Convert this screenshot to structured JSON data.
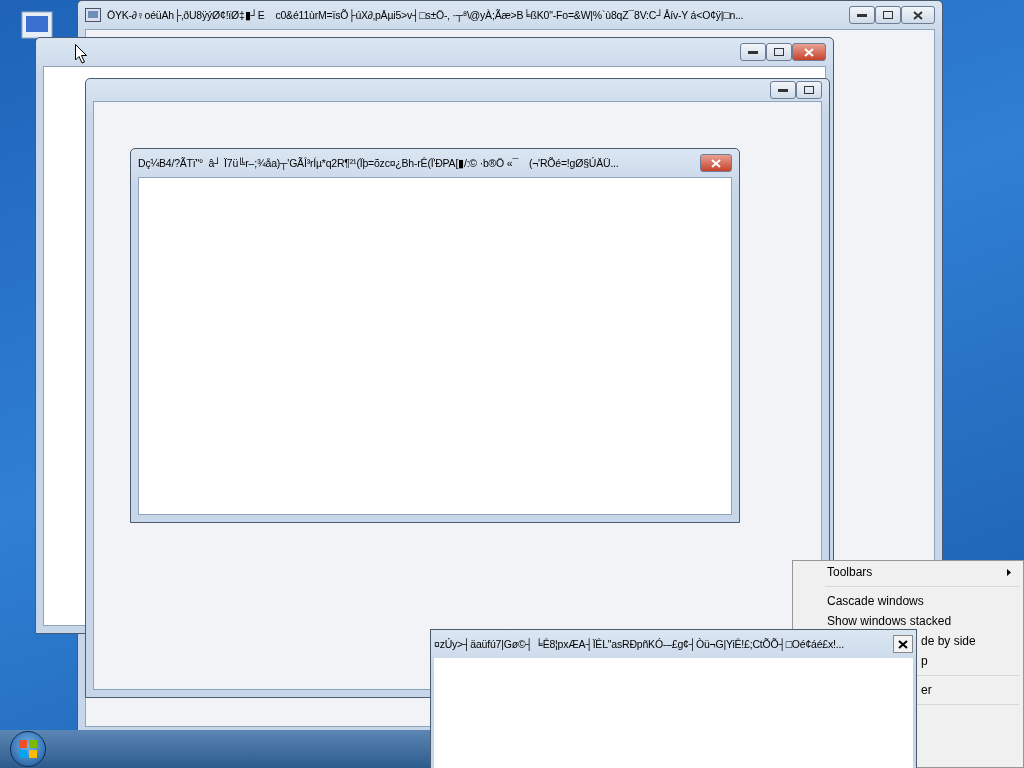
{
  "windows": [
    {
      "kind": "main",
      "title": "ÖYK-∂♀oéüAh├‚ðU8ÿýØ¢!ïØ‡▮┘E    c0&é11ùrM=ïsÕ├úX∂‚pĀµi5>v┤□s±Ö-‚ ·┬⁸\\@yÀ;Ãæ>B╘ßK0\"-Fo=&W|%`ù8qZ¯8V:C┘Åív-Y á<O¢ÿ|□n..."
    },
    {
      "kind": "frame"
    },
    {
      "kind": "inner"
    },
    {
      "kind": "dialog",
      "title": "Dç¼B4/?ÃTï\"°  â┘ Ï7ü╚r–;¾åa)┬'GÃÎ³rÍµ*q2R¶²¹(Ïþ=õzc¤¿Bh-rÊ(Ï'ÐPA[▮/:© ·b®Ö «¯    (¬'RÕé=!gØ§ÚÄÜ..."
    },
    {
      "kind": "tool",
      "title": "¤zÚy>┤äaüfú7|Gø©┤ ╘Ê8¦pxÆA┤ÏÊL\"asRÐpñKÓ-–£g¢┤Òü¬G|YiÊ!£;CtÕÕ┤□Oé¢áé£x!..."
    }
  ],
  "context_menu": {
    "items": [
      {
        "kind": "submenu",
        "label": "Toolbars"
      },
      {
        "kind": "separator"
      },
      {
        "kind": "item",
        "label": "Cascade windows"
      },
      {
        "kind": "item",
        "label": "Show windows stacked"
      },
      {
        "kind": "covered",
        "label": "de by side"
      },
      {
        "kind": "covered",
        "label": "p"
      },
      {
        "kind": "separator"
      },
      {
        "kind": "covered",
        "label": "er"
      },
      {
        "kind": "separator"
      }
    ]
  }
}
